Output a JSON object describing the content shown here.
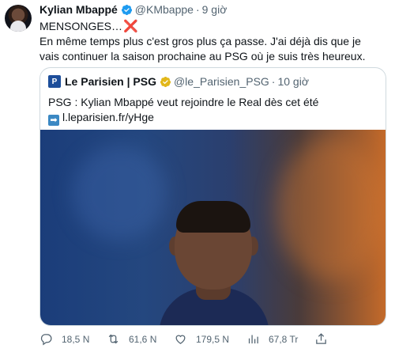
{
  "tweet": {
    "author_name": "Kylian Mbappé",
    "handle": "@KMbappe",
    "separator": "·",
    "time": "9 giờ",
    "line1_text": "MENSONGES…",
    "line1_emoji": "❌",
    "body": "En même temps plus c'est gros plus ça passe. J'ai déjà dis que je vais continuer la saison prochaine au PSG où je suis très heureux."
  },
  "quote": {
    "source_name": "Le Parisien | PSG",
    "handle": "@le_Parisien_PSG",
    "separator": "·",
    "time": "10 giờ",
    "text": "PSG : Kylian Mbappé veut rejoindre le Real dès cet été",
    "link_icon": "right-arrow-icon",
    "link": "l.leparisien.fr/yHge"
  },
  "actions": {
    "reply_count": "18,5 N",
    "retweet_count": "61,6 N",
    "like_count": "179,5 N",
    "views_count": "67,8 Tr"
  },
  "colors": {
    "verified_blue": "#1d9bf0",
    "gold_badge": "#e2b719",
    "muted": "#536471",
    "text": "#0f1419",
    "border": "#cfd9de"
  }
}
